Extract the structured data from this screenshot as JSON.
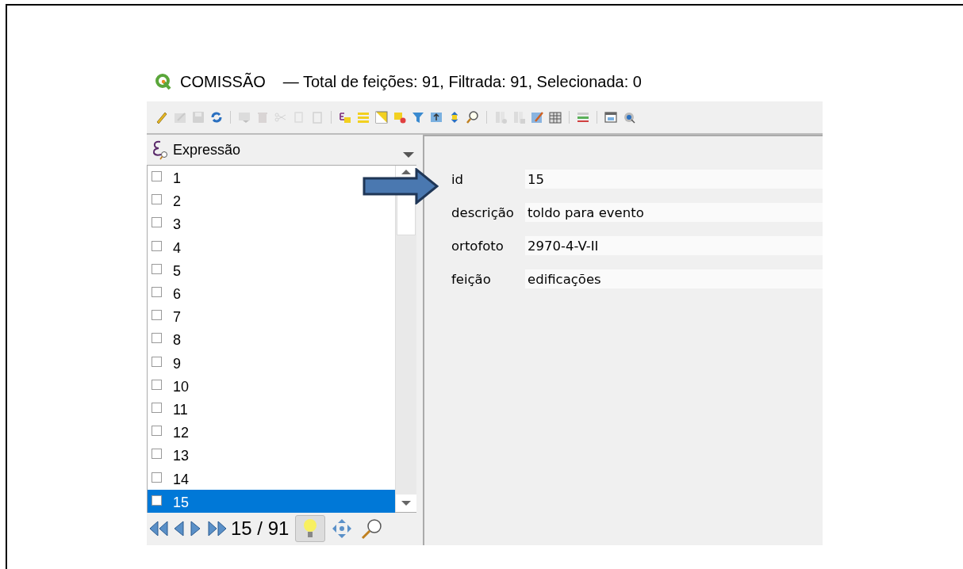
{
  "window": {
    "title": "COMISSÃO",
    "subtitle": "— Total de feições: 91, Filtrada: 91, Selecionada: 0"
  },
  "expression": {
    "label": "Expressão"
  },
  "features": [
    {
      "label": "1",
      "checked": false,
      "selected": false
    },
    {
      "label": "2",
      "checked": false,
      "selected": false
    },
    {
      "label": "3",
      "checked": false,
      "selected": false
    },
    {
      "label": "4",
      "checked": false,
      "selected": false
    },
    {
      "label": "5",
      "checked": false,
      "selected": false
    },
    {
      "label": "6",
      "checked": false,
      "selected": false
    },
    {
      "label": "7",
      "checked": false,
      "selected": false
    },
    {
      "label": "8",
      "checked": false,
      "selected": false
    },
    {
      "label": "9",
      "checked": false,
      "selected": false
    },
    {
      "label": "10",
      "checked": false,
      "selected": false
    },
    {
      "label": "11",
      "checked": false,
      "selected": false
    },
    {
      "label": "12",
      "checked": false,
      "selected": false
    },
    {
      "label": "13",
      "checked": false,
      "selected": false
    },
    {
      "label": "14",
      "checked": false,
      "selected": false
    },
    {
      "label": "15",
      "checked": false,
      "selected": true
    }
  ],
  "navigation": {
    "position": "15 / 91"
  },
  "form": [
    {
      "label": "id",
      "value": "15"
    },
    {
      "label": "descrição",
      "value": "toldo para evento"
    },
    {
      "label": "ortofoto",
      "value": "2970-4-V-II"
    },
    {
      "label": "feição",
      "value": "edificações"
    }
  ]
}
